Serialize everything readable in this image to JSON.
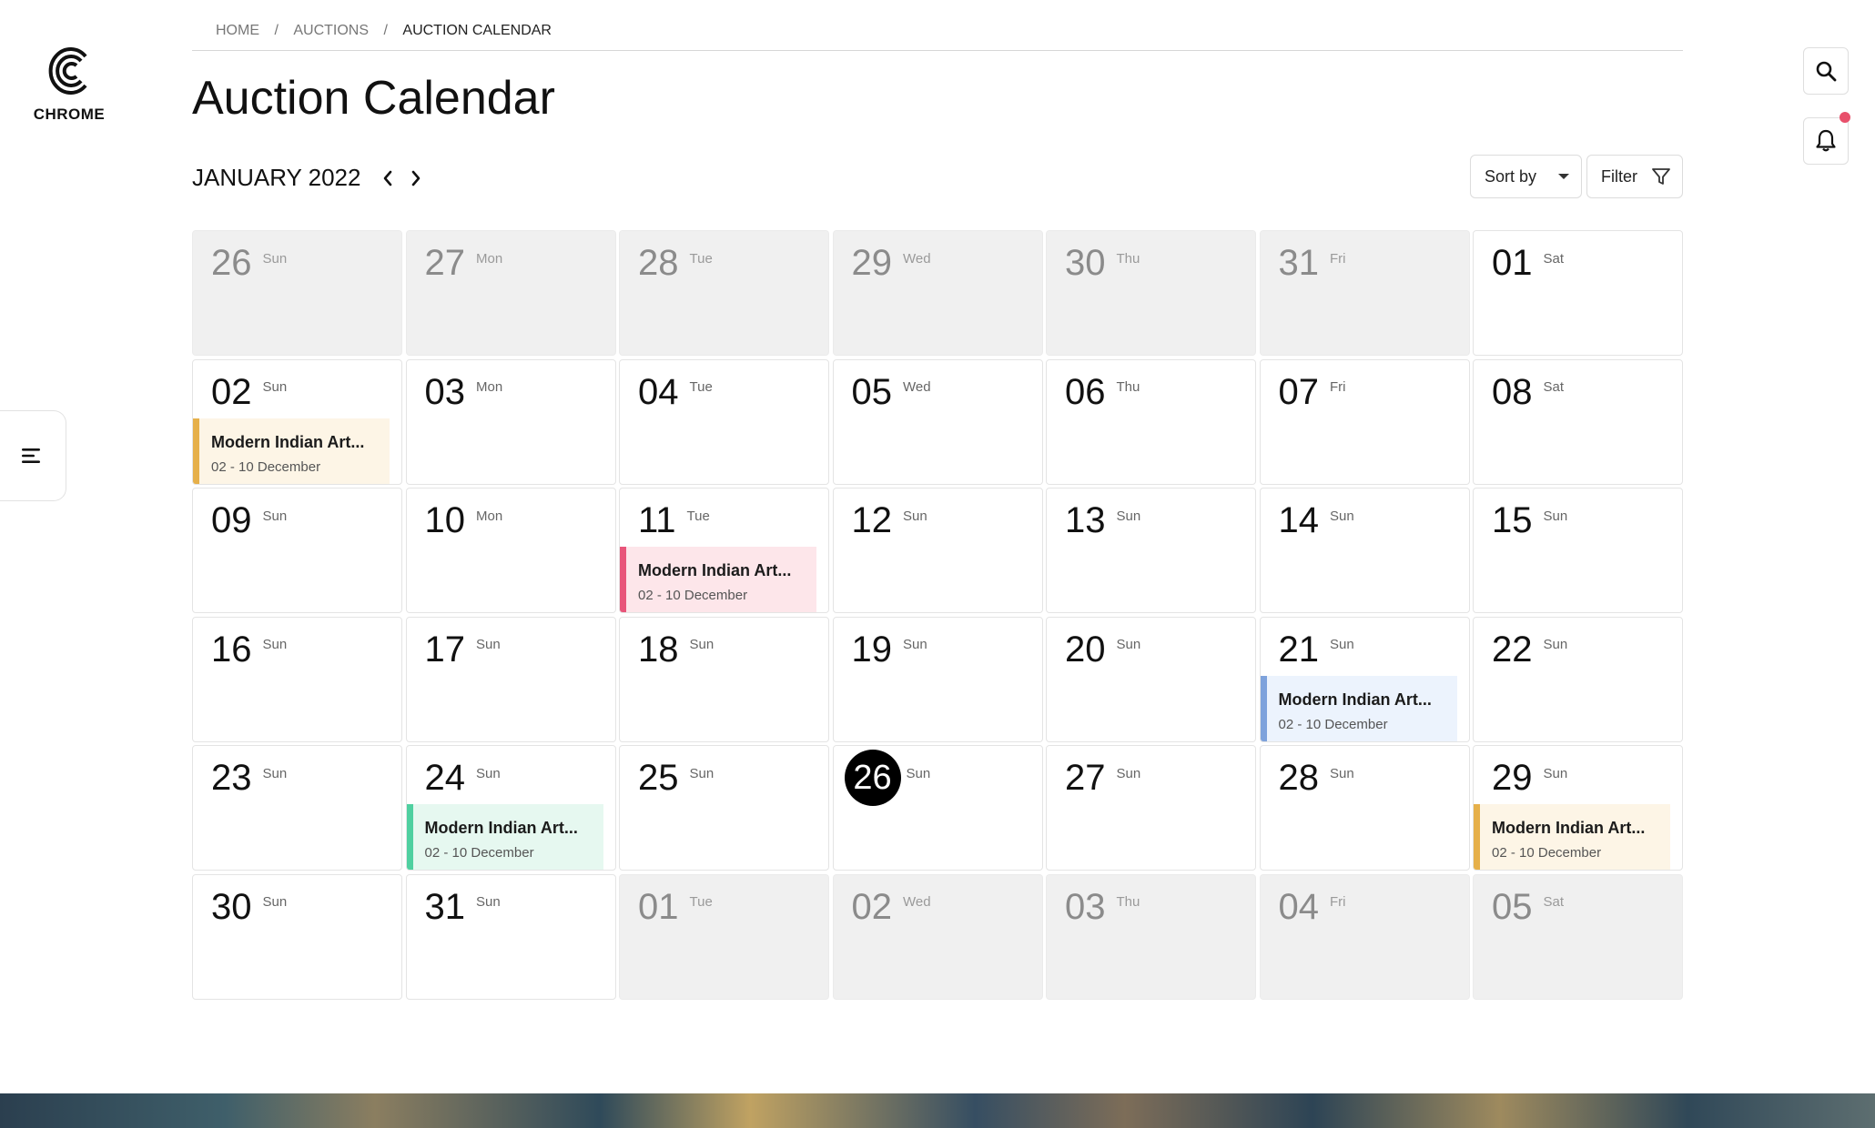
{
  "brand": {
    "name": "CHROME"
  },
  "breadcrumb": [
    {
      "label": "HOME"
    },
    {
      "label": "AUCTIONS"
    },
    {
      "label": "AUCTION CALENDAR"
    }
  ],
  "breadcrumb_separator": "/",
  "page_title": "Auction Calendar",
  "month_label": "JANUARY 2022",
  "controls": {
    "sort_label": "Sort by",
    "filter_label": "Filter"
  },
  "icons": {
    "logo": "logo-c-icon",
    "menu": "menu-lines-icon",
    "search": "search-icon",
    "notification": "bell-icon",
    "prev": "chevron-left-icon",
    "next": "chevron-right-icon",
    "sort": "caret-down-icon",
    "filter": "funnel-icon"
  },
  "colors": {
    "notification_dot": "#e8506b",
    "today": "#000000",
    "outside_month": "#f0f0f0",
    "event_yellow_bar": "#e6b04a",
    "event_yellow_bg": "#fdf5e6",
    "event_pink_bar": "#e8557a",
    "event_pink_bg": "#fde6ea",
    "event_blue_bar": "#7ea2dc",
    "event_blue_bg": "#ecf3fd",
    "event_green_bar": "#4fd0a0",
    "event_green_bg": "#e6f8f0"
  },
  "calendar": {
    "days": [
      {
        "num": "26",
        "name": "Sun",
        "outside": true
      },
      {
        "num": "27",
        "name": "Mon",
        "outside": true
      },
      {
        "num": "28",
        "name": "Tue",
        "outside": true
      },
      {
        "num": "29",
        "name": "Wed",
        "outside": true
      },
      {
        "num": "30",
        "name": "Thu",
        "outside": true
      },
      {
        "num": "31",
        "name": "Fri",
        "outside": true
      },
      {
        "num": "01",
        "name": "Sat"
      },
      {
        "num": "02",
        "name": "Sun",
        "event": {
          "title": "Modern Indian Art...",
          "dates": "02 - 10 December",
          "color": "yellow"
        }
      },
      {
        "num": "03",
        "name": "Mon"
      },
      {
        "num": "04",
        "name": "Tue"
      },
      {
        "num": "05",
        "name": "Wed"
      },
      {
        "num": "06",
        "name": "Thu"
      },
      {
        "num": "07",
        "name": "Fri"
      },
      {
        "num": "08",
        "name": "Sat"
      },
      {
        "num": "09",
        "name": "Sun"
      },
      {
        "num": "10",
        "name": "Mon"
      },
      {
        "num": "11",
        "name": "Tue",
        "event": {
          "title": "Modern Indian Art...",
          "dates": "02 - 10 December",
          "color": "pink"
        }
      },
      {
        "num": "12",
        "name": "Sun"
      },
      {
        "num": "13",
        "name": "Sun"
      },
      {
        "num": "14",
        "name": "Sun"
      },
      {
        "num": "15",
        "name": "Sun"
      },
      {
        "num": "16",
        "name": "Sun"
      },
      {
        "num": "17",
        "name": "Sun"
      },
      {
        "num": "18",
        "name": "Sun"
      },
      {
        "num": "19",
        "name": "Sun"
      },
      {
        "num": "20",
        "name": "Sun"
      },
      {
        "num": "21",
        "name": "Sun",
        "event": {
          "title": "Modern Indian Art...",
          "dates": "02 - 10 December",
          "color": "blue"
        }
      },
      {
        "num": "22",
        "name": "Sun"
      },
      {
        "num": "23",
        "name": "Sun"
      },
      {
        "num": "24",
        "name": "Sun",
        "event": {
          "title": "Modern Indian Art...",
          "dates": "02 - 10 December",
          "color": "green"
        }
      },
      {
        "num": "25",
        "name": "Sun"
      },
      {
        "num": "26",
        "name": "Sun",
        "today": true
      },
      {
        "num": "27",
        "name": "Sun"
      },
      {
        "num": "28",
        "name": "Sun"
      },
      {
        "num": "29",
        "name": "Sun",
        "event": {
          "title": "Modern Indian Art...",
          "dates": "02 - 10 December",
          "color": "yellow"
        }
      },
      {
        "num": "30",
        "name": "Sun"
      },
      {
        "num": "31",
        "name": "Sun"
      },
      {
        "num": "01",
        "name": "Tue",
        "outside": true
      },
      {
        "num": "02",
        "name": "Wed",
        "outside": true
      },
      {
        "num": "03",
        "name": "Thu",
        "outside": true
      },
      {
        "num": "04",
        "name": "Fri",
        "outside": true
      },
      {
        "num": "05",
        "name": "Sat",
        "outside": true
      }
    ]
  }
}
